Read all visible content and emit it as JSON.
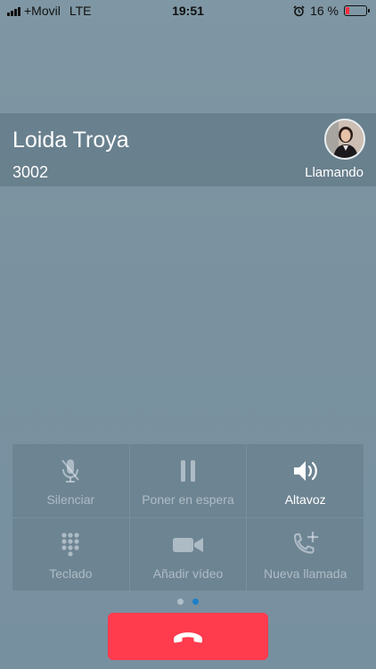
{
  "status_bar": {
    "carrier": "+Movil",
    "network": "LTE",
    "time": "19:51",
    "battery_text": "16 %",
    "battery_level": 0.16
  },
  "caller": {
    "name": "Loida Troya",
    "number": "3002",
    "status": "Llamando"
  },
  "controls": [
    {
      "label": "Silenciar",
      "icon": "mic-off-icon",
      "active": false
    },
    {
      "label": "Poner en espera",
      "icon": "pause-icon",
      "active": false
    },
    {
      "label": "Altavoz",
      "icon": "speaker-icon",
      "active": true
    },
    {
      "label": "Teclado",
      "icon": "keypad-icon",
      "active": false
    },
    {
      "label": "Añadir vídeo",
      "icon": "video-icon",
      "active": false
    },
    {
      "label": "Nueva llamada",
      "icon": "add-call-icon",
      "active": false
    }
  ],
  "pager": {
    "pages": 2,
    "current": 2
  },
  "colors": {
    "end_call": "#ff3b4e",
    "pager_active": "#1c7fc9",
    "battery_low": "#ff2d3f"
  }
}
